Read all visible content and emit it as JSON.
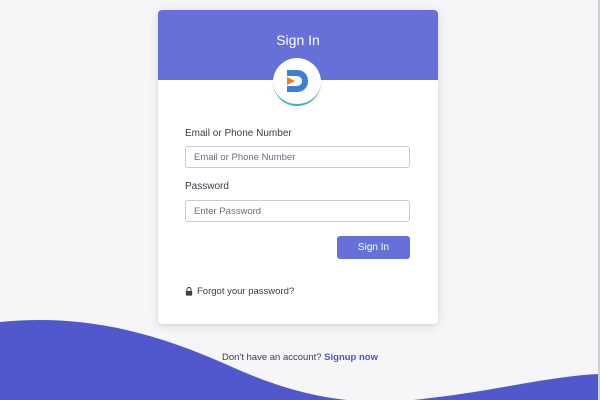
{
  "card": {
    "title": "Sign In",
    "logo": {
      "icon": "d-logo-icon",
      "colors": {
        "blue": "#3d7fd6",
        "orange": "#f07a2a",
        "teal": "#3bb1b9"
      }
    }
  },
  "form": {
    "email": {
      "label": "Email or Phone Number",
      "placeholder": "Email or Phone Number",
      "value": ""
    },
    "password": {
      "label": "Password",
      "placeholder": "Enter Password",
      "value": ""
    },
    "submit_label": "Sign In",
    "forgot_label": "Forgot your password?",
    "forgot_icon": "lock-icon"
  },
  "footer": {
    "prompt": "Don't have an account?",
    "signup_label": "Signup now"
  },
  "colors": {
    "accent": "#6770d8",
    "wave": "#5058cc",
    "background": "#f6f6f8",
    "link": "#4b55c8"
  }
}
